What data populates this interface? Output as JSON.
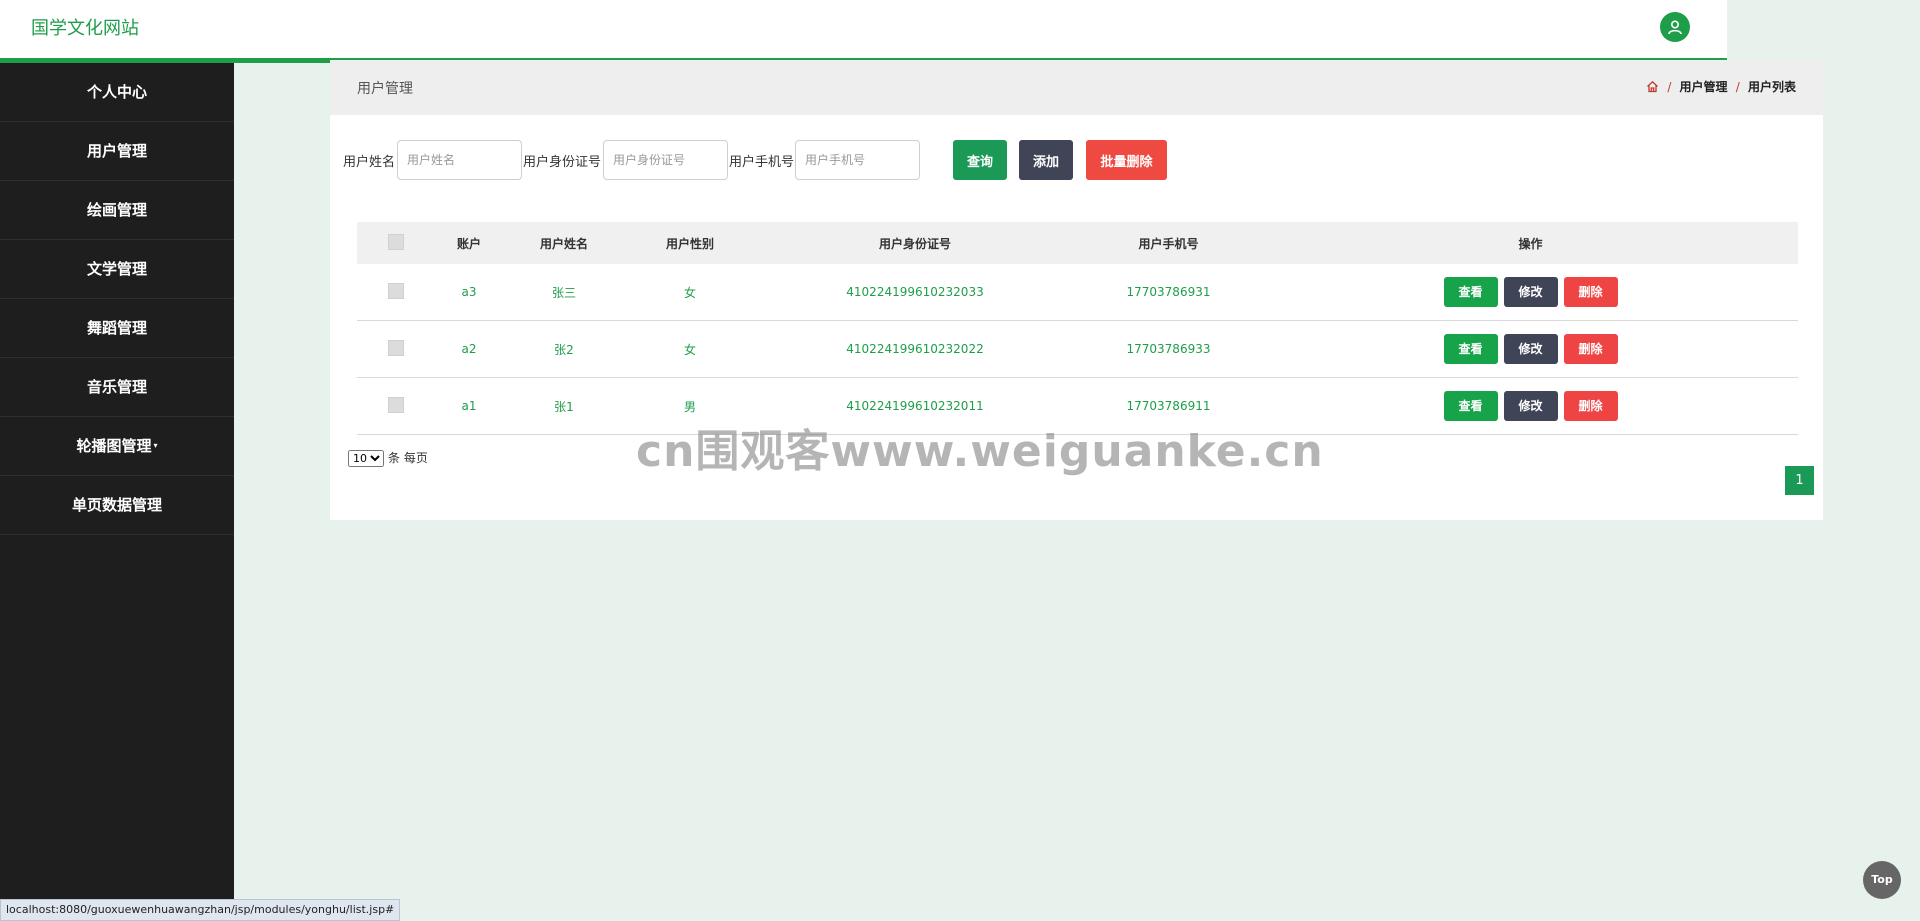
{
  "header": {
    "site_title": "国学文化网站",
    "user_icon": "user-icon"
  },
  "sidebar": {
    "items": [
      {
        "label": "个人中心"
      },
      {
        "label": "用户管理"
      },
      {
        "label": "绘画管理"
      },
      {
        "label": "文学管理"
      },
      {
        "label": "舞蹈管理"
      },
      {
        "label": "音乐管理"
      },
      {
        "label": "轮播图管理"
      },
      {
        "label": "单页数据管理"
      }
    ]
  },
  "page_header": {
    "title": "用户管理",
    "breadcrumb": [
      "用户管理",
      "用户列表"
    ],
    "separator": "/",
    "home_icon": "home-icon"
  },
  "search": {
    "name_label": "用户姓名",
    "name_placeholder": "用户姓名",
    "id_label": "用户身份证号",
    "id_placeholder": "用户身份证号",
    "phone_label": "用户手机号",
    "phone_placeholder": "用户手机号",
    "query_label": "查询",
    "add_label": "添加",
    "batch_delete_label": "批量删除"
  },
  "table": {
    "columns": [
      "账户",
      "用户姓名",
      "用户性别",
      "用户身份证号",
      "用户手机号",
      "操作"
    ],
    "rows": [
      {
        "account": "a3",
        "name": "张三",
        "gender": "女",
        "id_number": "410224199610232033",
        "phone": "17703786931"
      },
      {
        "account": "a2",
        "name": "张2",
        "gender": "女",
        "id_number": "410224199610232022",
        "phone": "17703786933"
      },
      {
        "account": "a1",
        "name": "张1",
        "gender": "男",
        "id_number": "410224199610232011",
        "phone": "17703786911"
      }
    ],
    "actions": {
      "view": "查看",
      "edit": "修改",
      "delete": "删除"
    }
  },
  "pagination": {
    "page_size": "10",
    "page_size_suffix": "条 每页",
    "current_page": "1"
  },
  "watermark": "cn围观客www.weiguanke.cn",
  "status_url": "localhost:8080/guoxuewenhuawangzhan/jsp/modules/yonghu/list.jsp#",
  "top_button": "Top",
  "colors": {
    "brand_green": "#1f9e4a",
    "sidebar_bg": "#1e1e1e",
    "page_bg": "#e6f2eb",
    "danger": "#ef4444",
    "dark": "#3f4456"
  }
}
